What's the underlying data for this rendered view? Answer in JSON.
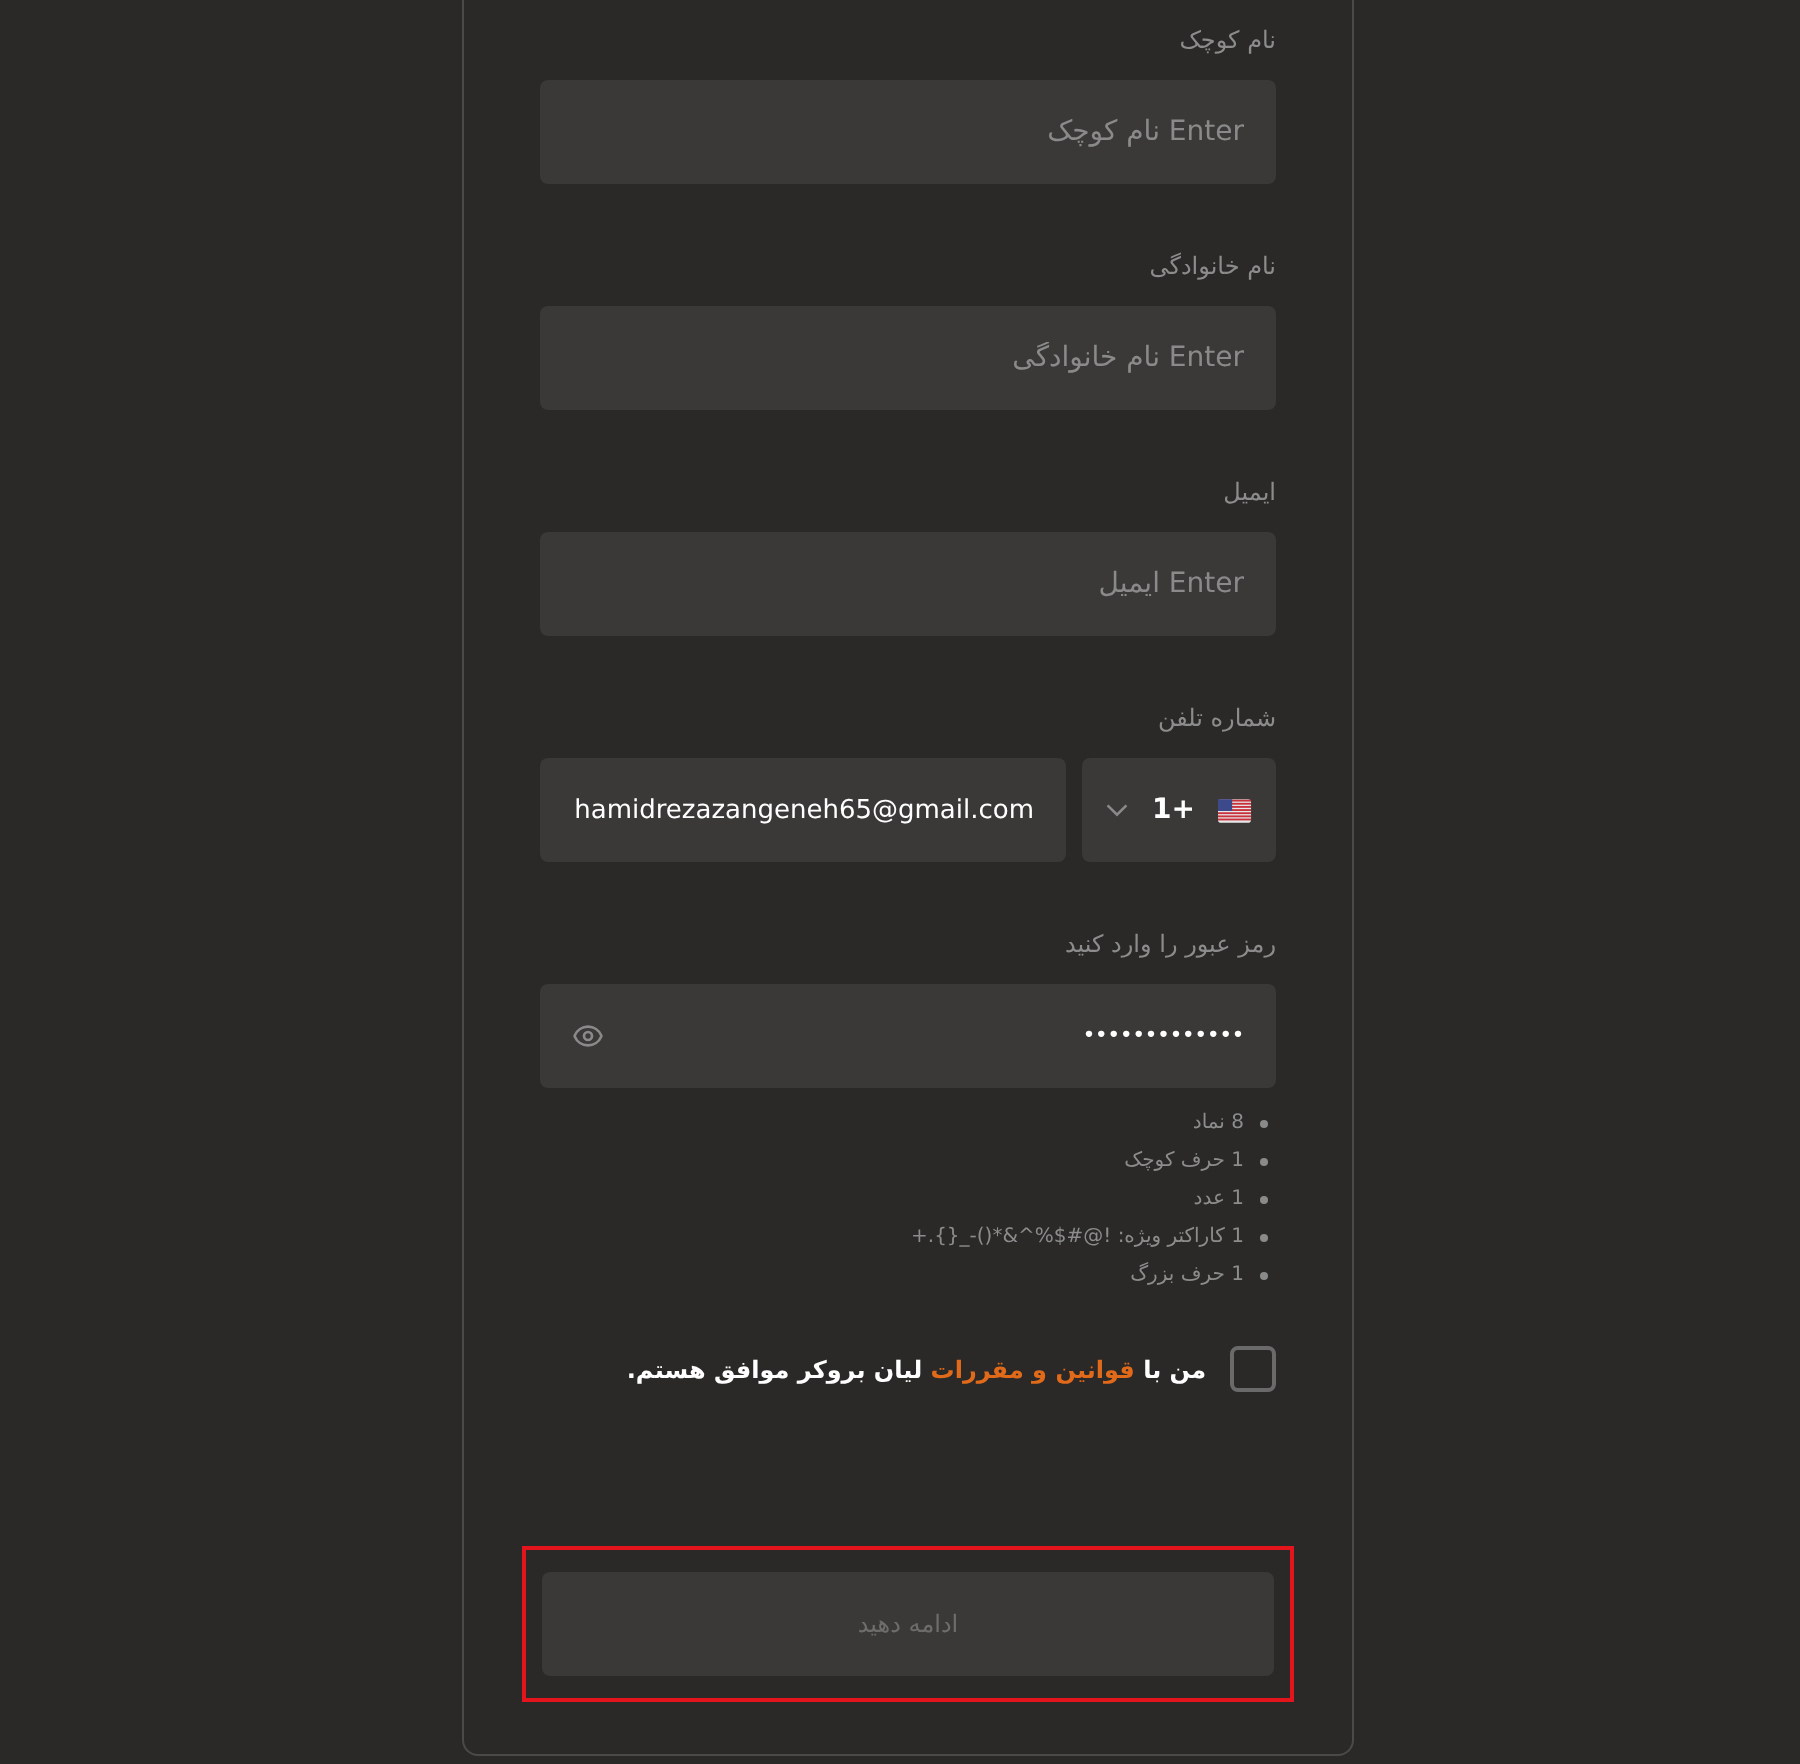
{
  "fields": [
    {
      "label": "نام کوچک",
      "placeholder": "Enter نام کوچک"
    },
    {
      "label": "نام خانوادگی",
      "placeholder": "Enter نام خانوادگی"
    },
    {
      "label": "ایمیل",
      "placeholder": "Enter ایمیل"
    }
  ],
  "phone": {
    "label": "شماره تلفن",
    "country_code": "1+",
    "value": "hamidrezazangeneh65@gmail.com"
  },
  "password": {
    "label": "رمز عبور را وارد کنید",
    "value": "•••••••••••••"
  },
  "requirements": [
    "8 نماد",
    "1 حرف کوچک",
    "1 عدد",
    "1 کاراکتر ویژه: !@#$%^&*()-_{}.+",
    "1 حرف بزرگ"
  ],
  "agreement": {
    "checked": false,
    "text_before": "من با",
    "link": "قوانین و مقررات",
    "text_after": "لیان بروکر موافق هستم."
  },
  "submit": {
    "label": "ادامه دهید",
    "disabled": true,
    "highlighted": true
  }
}
